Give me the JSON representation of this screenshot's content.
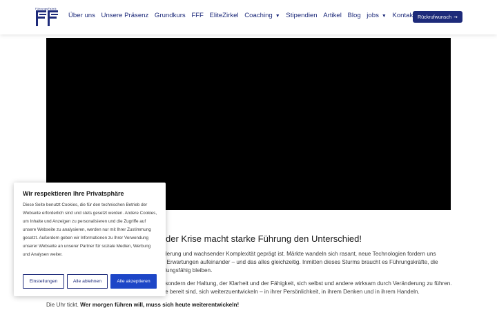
{
  "header": {
    "logo_text": "FührungsFabrik",
    "nav": [
      {
        "label": "Über uns",
        "dropdown": false
      },
      {
        "label": "Unsere Präsenz",
        "dropdown": false
      },
      {
        "label": "Grundkurs",
        "dropdown": false
      },
      {
        "label": "FFF",
        "dropdown": false
      },
      {
        "label": "EliteZirkel",
        "dropdown": false
      },
      {
        "label": "Coaching",
        "dropdown": true
      },
      {
        "label": "Stipendien",
        "dropdown": false
      },
      {
        "label": "Artikel",
        "dropdown": false
      },
      {
        "label": "Blog",
        "dropdown": false
      },
      {
        "label": "jobs",
        "dropdown": true
      },
      {
        "label": "Kontakt",
        "dropdown": false
      }
    ],
    "cta_label": "Rückrufwunsch",
    "cta_icon": "arrow-right-icon"
  },
  "content": {
    "headline": "der Krise macht starke Führung den Unterschied!",
    "p1_line1": "änderung und wachsender Komplexität geprägt ist. Märkte wandeln sich rasant, neue Technologien fordern uns",
    "p1_line2": "en Erwartungen aufeinander – und das alles gleichzeitig. Inmitten dieses Sturms braucht es Führungskräfte, die",
    "p1_line3": "ndlungsfähig bleiben.",
    "p2_line1": "n, sondern der Haltung, der Klarheit und der Fähigkeit, sich selbst und andere wirksam durch Veränderung zu führen.",
    "p2_line2": "äfte bereit sind, sich weiterzuentwickeln – in ihrer Persönlichkeit, in ihrem Denken und in ihrem Handeln.",
    "p3_lead": "Die Uhr tickt. ",
    "p3_bold": "Wer morgen führen will, muss sich heute weiterentwickeln!"
  },
  "cookie": {
    "title": "Wir respektieren Ihre Privatsphäre",
    "body": "Diese Seite benutzt Cookies, die für den technischen Betrieb der Webseite erforderlich sind und stets gesetzt werden. Andere Cookies, um Inhalte und Anzeigen zu personalisieren und die Zugriffe auf unsere Webseite zu analysieren, werden nur mit Ihrer Zustimmung gesetzt. Außerdem geben wir Informationen zu Ihrer Verwendung unserer Webseite an unserer Partner für soziale Medien, Werbung und Analysen weiter.",
    "settings_label": "Einstellungen",
    "reject_label": "Alle ablehnen",
    "accept_label": "Alle akzeptieren"
  },
  "colors": {
    "brand": "#1d2a7a",
    "accept": "#1d46c7",
    "video": "#000000"
  }
}
